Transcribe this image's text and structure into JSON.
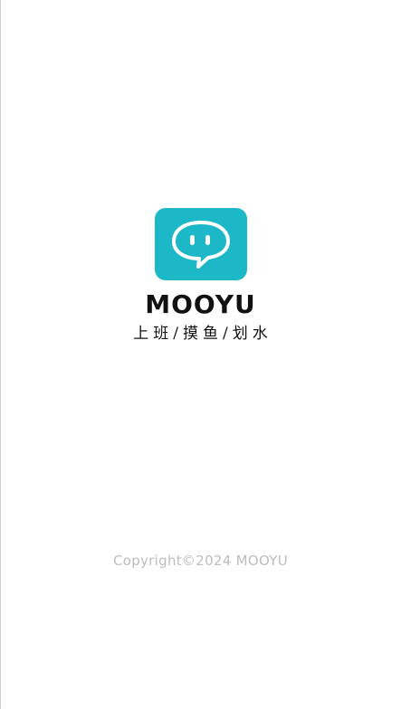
{
  "splash": {
    "logo_icon": "speech-bubble-face-icon",
    "brand_color": "#1cb8c8",
    "app_name": "MOOYU",
    "slogan": "上班/摸鱼/划水",
    "copyright": "Copyright©2024 MOOYU"
  }
}
